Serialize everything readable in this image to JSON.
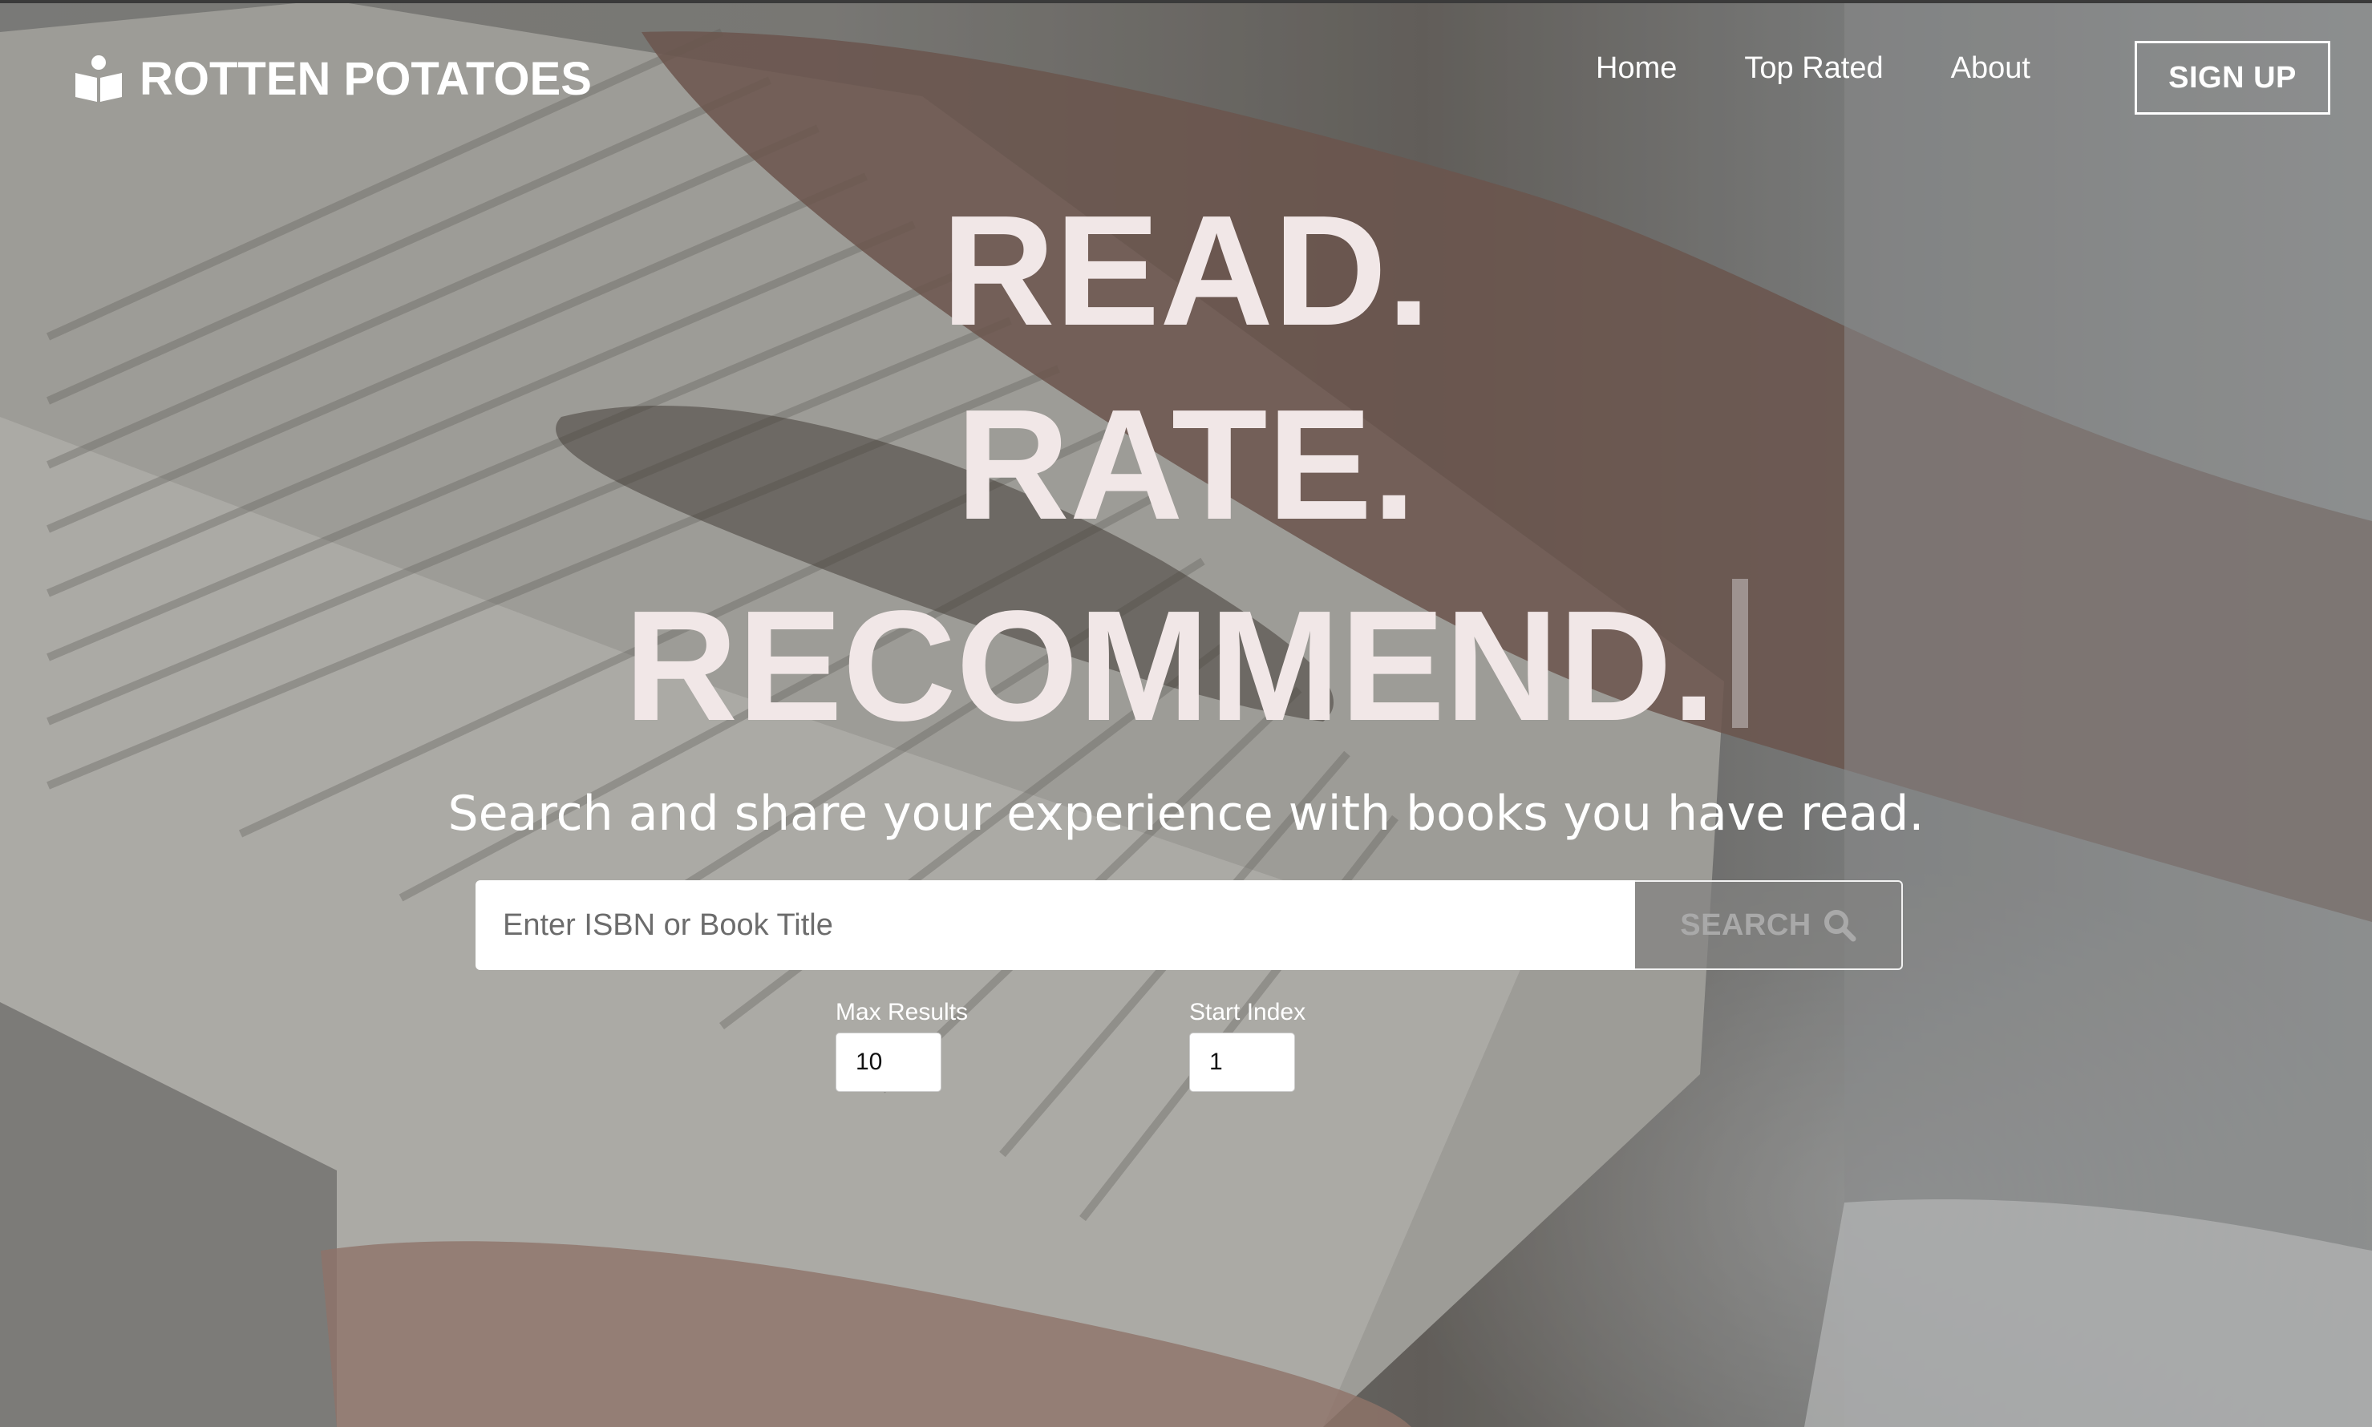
{
  "brand": {
    "name": "ROTTEN POTATOES",
    "icon": "book-reader-icon"
  },
  "nav": {
    "items": [
      {
        "label": "Home"
      },
      {
        "label": "Top Rated"
      },
      {
        "label": "About"
      }
    ],
    "signup_label": "SIGN UP"
  },
  "hero": {
    "line1": "READ.",
    "line2": "RATE.",
    "line3": "RECOMMEND.",
    "subtitle": "Search and share your experience with books you have read."
  },
  "search": {
    "placeholder": "Enter ISBN or Book Title",
    "value": "",
    "button_label": "SEARCH",
    "button_icon": "search-icon"
  },
  "options": {
    "max_results": {
      "label": "Max Results",
      "value": "10"
    },
    "start_index": {
      "label": "Start Index",
      "value": "1"
    }
  },
  "colors": {
    "hero_text": "#f1e7e7",
    "nav_text": "#ffffff",
    "search_button_text": "#a9a9a9"
  }
}
